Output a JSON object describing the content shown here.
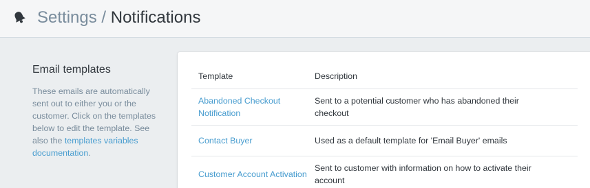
{
  "header": {
    "icon": "bell-icon",
    "breadcrumb_parent": "Settings",
    "separator": "/",
    "breadcrumb_current": "Notifications"
  },
  "sidebar": {
    "heading": "Email templates",
    "description": "These emails are automatically sent out to either you or the customer. Click on the templates below to edit the template. See also the",
    "link_text": "templates variables documentation",
    "trailing": "."
  },
  "table": {
    "columns": [
      "Template",
      "Description"
    ],
    "rows": [
      {
        "template": "Abandoned Checkout Notification",
        "description": "Sent to a potential customer who has abandoned their checkout"
      },
      {
        "template": "Contact Buyer",
        "description": "Used as a default template for 'Email Buyer' emails"
      },
      {
        "template": "Customer Account Activation",
        "description": "Sent to customer with information on how to activate their account"
      }
    ]
  },
  "colors": {
    "link": "#479ccf",
    "muted": "#798c9c",
    "text": "#31373d",
    "background": "#ebeef0"
  }
}
